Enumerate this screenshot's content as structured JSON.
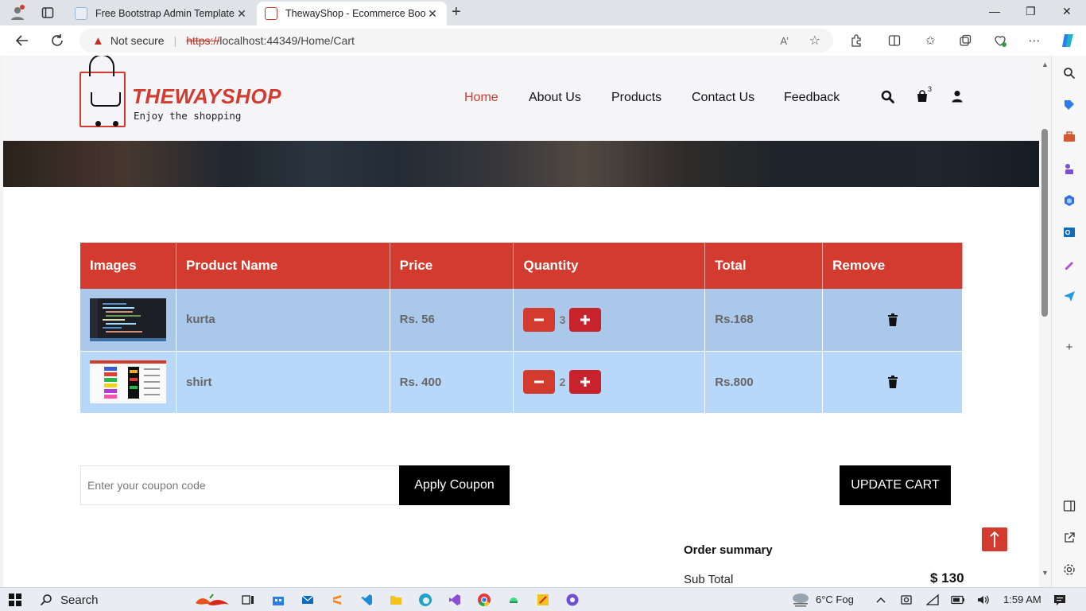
{
  "browser": {
    "tabs": [
      {
        "title": "Free Bootstrap Admin Template :",
        "active": false
      },
      {
        "title": "ThewayShop - Ecommerce Boots",
        "active": true
      }
    ],
    "security_label": "Not secure",
    "url_protocol": "https://",
    "url_rest": "localhost:44349/Home/Cart"
  },
  "site": {
    "logo_name": "THEWAYSHOP",
    "logo_tagline": "Enjoy the shopping",
    "nav": [
      "Home",
      "About Us",
      "Products",
      "Contact Us",
      "Feedback"
    ],
    "active_nav": "Home",
    "cart_count": "3"
  },
  "cart": {
    "headers": [
      "Images",
      "Product Name",
      "Price",
      "Quantity",
      "Total",
      "Remove"
    ],
    "rows": [
      {
        "name": "kurta",
        "price": "Rs. 56",
        "qty": "3",
        "total": "Rs.168"
      },
      {
        "name": "shirt",
        "price": "Rs. 400",
        "qty": "2",
        "total": "Rs.800"
      }
    ]
  },
  "coupon": {
    "placeholder": "Enter your coupon code",
    "apply_label": "Apply Coupon",
    "update_label": "UPDATE CART"
  },
  "summary": {
    "title": "Order summary",
    "subtotal_label": "Sub Total",
    "subtotal_value": "$ 130"
  },
  "taskbar": {
    "search_label": "Search",
    "weather": "6°C  Fog",
    "time": "1:59 AM"
  },
  "colors": {
    "brand_red": "#d33b2f",
    "row1": "#a9c8ea",
    "row2": "#b8d8fa"
  }
}
